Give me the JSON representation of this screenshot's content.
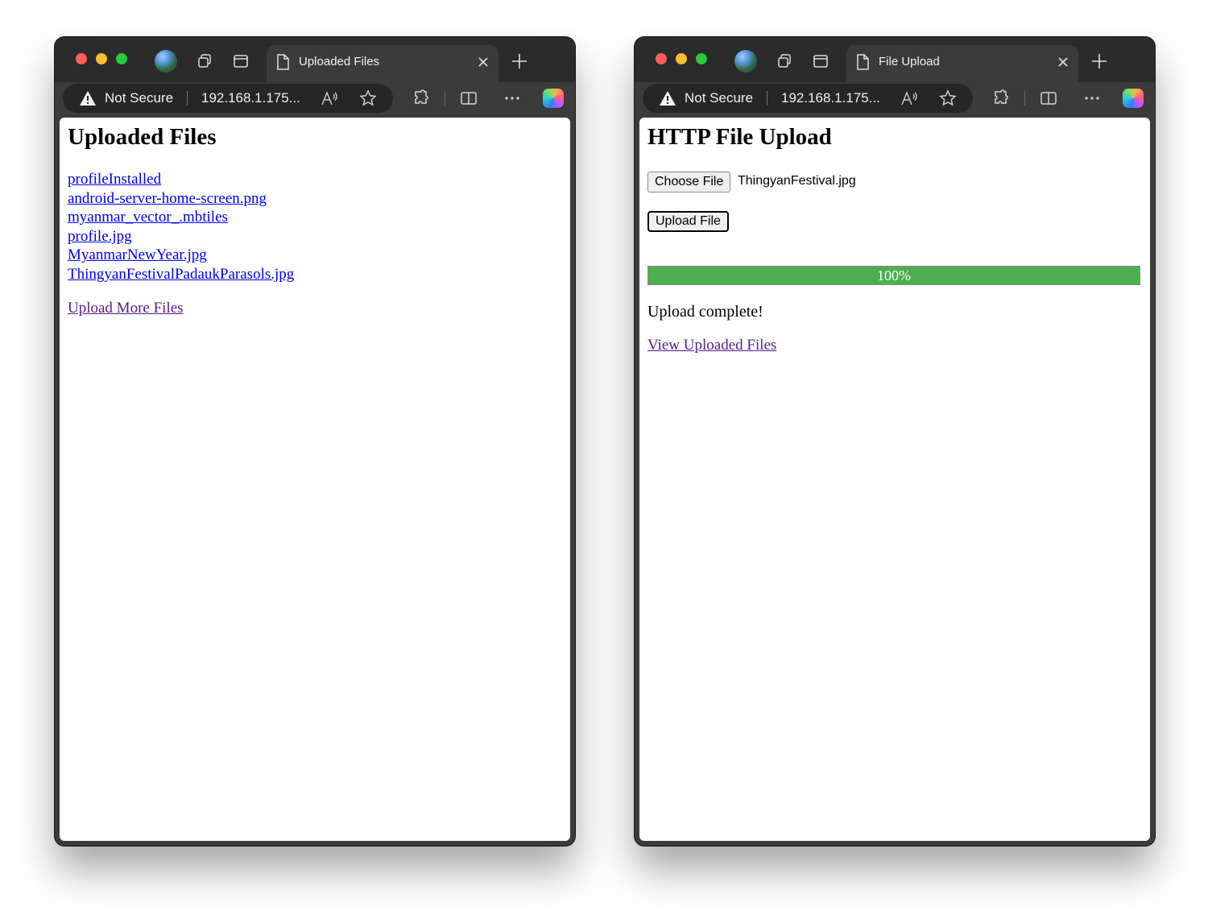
{
  "left_window": {
    "tab_title": "Uploaded Files",
    "address": {
      "security_label": "Not Secure",
      "url": "192.168.1.175..."
    },
    "page": {
      "title": "Uploaded Files",
      "files": [
        "profileInstalled",
        "android-server-home-screen.png",
        "myanmar_vector_.mbtiles",
        "profile.jpg",
        "MyanmarNewYear.jpg",
        "ThingyanFestivalPadaukParasols.jpg"
      ],
      "upload_more_label": "Upload More Files"
    }
  },
  "right_window": {
    "tab_title": "File Upload",
    "address": {
      "security_label": "Not Secure",
      "url": "192.168.1.175..."
    },
    "page": {
      "title": "HTTP File Upload",
      "choose_button_label": "Choose File",
      "chosen_file": "ThingyanFestival.jpg",
      "upload_button_label": "Upload File",
      "progress_text": "100%",
      "progress_fraction": 1.0,
      "status_text": "Upload complete!",
      "view_files_label": "View Uploaded Files"
    }
  },
  "colors": {
    "progress_fill": "#4caf50",
    "link": "#0000ee",
    "visited_link": "#551a8b",
    "traffic_red": "#ff5f57",
    "traffic_yellow": "#febc2e",
    "traffic_green": "#28c840"
  },
  "icons": [
    "globe-icon",
    "tab-groups-icon",
    "tab-actions-icon",
    "page-icon",
    "close-icon",
    "new-tab-icon",
    "warning-icon",
    "read-aloud-icon",
    "favorite-star-icon",
    "extensions-icon",
    "split-screen-icon",
    "more-menu-icon",
    "copilot-icon"
  ]
}
